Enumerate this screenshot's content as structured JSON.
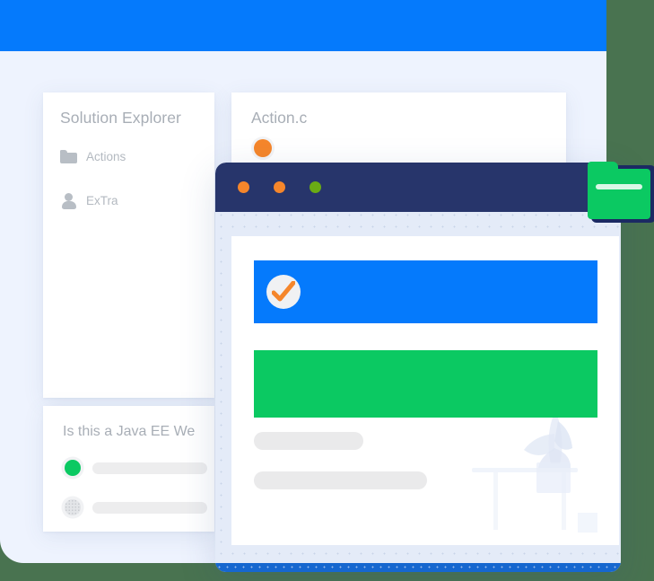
{
  "meta": {
    "scene": "layered IDE and browser mockup illustration",
    "colors": {
      "blue": "#057afc",
      "green": "#0bc962",
      "navy": "#27356b",
      "orange": "#f5862b",
      "chrome_green": "#6aab14",
      "page_background": "#eef3fe",
      "backdrop_green": "#497350",
      "placeholder_grey": "#eaeaeb",
      "muted_text": "#a8aeb6"
    }
  },
  "solution_explorer": {
    "title": "Solution Explorer",
    "items": [
      {
        "icon": "folder-icon",
        "label": "Actions"
      },
      {
        "icon": "person-icon",
        "label": "ExTra"
      }
    ]
  },
  "action_card": {
    "title": "Action.c",
    "status_dot": "orange",
    "code_field": {
      "value": "</>",
      "placeholder": "</>"
    }
  },
  "question_card": {
    "title": "Is this a Java EE We",
    "options": [
      {
        "state": "selected",
        "label": ""
      },
      {
        "state": "unselected",
        "label": ""
      }
    ]
  },
  "browser": {
    "traffic_lights": [
      {
        "name": "close",
        "color": "#f5862b"
      },
      {
        "name": "minimize",
        "color": "#f5862b"
      },
      {
        "name": "maximize",
        "color": "#6aab14"
      }
    ],
    "content": {
      "banner_blue": {
        "badge": "check-badge-icon"
      },
      "banner_green": {},
      "text_bars": [
        "",
        ""
      ]
    }
  },
  "folder_icon": {
    "name": "folder-icon",
    "color": "#0bc962"
  }
}
